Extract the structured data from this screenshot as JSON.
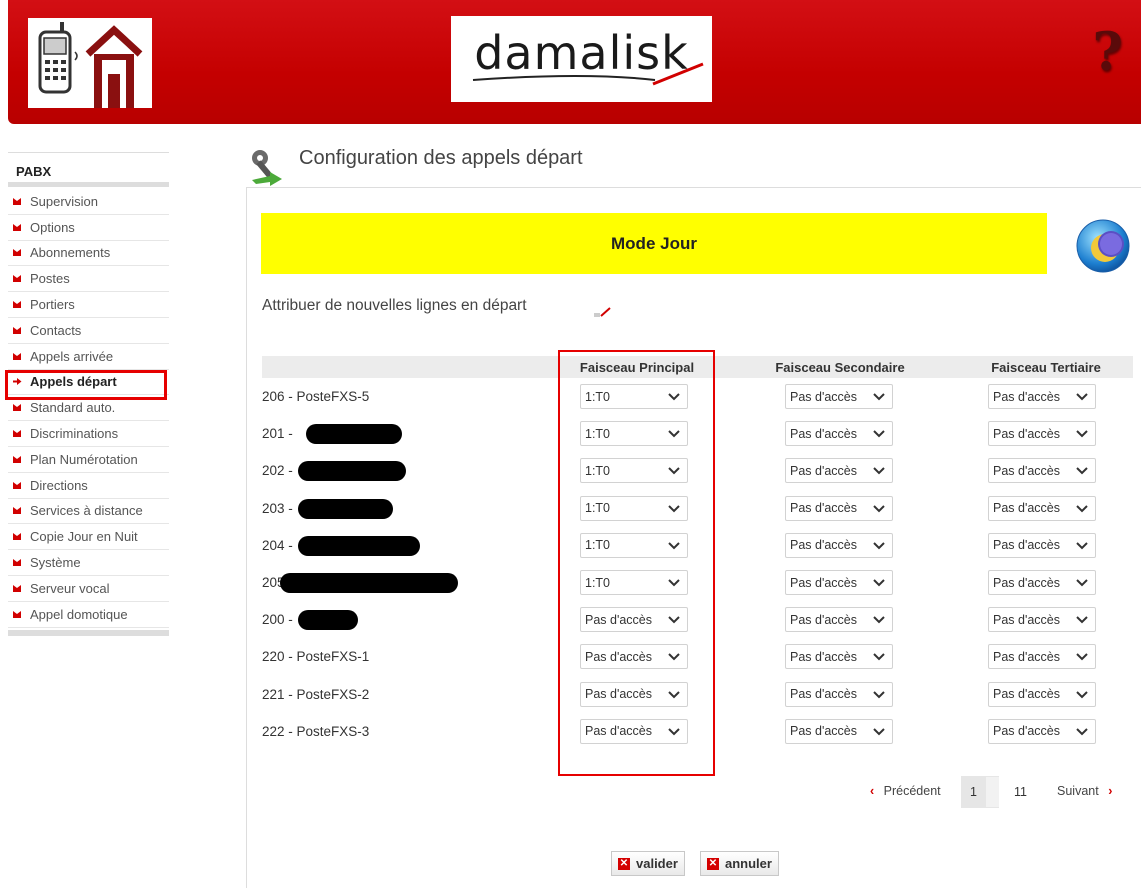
{
  "header": {
    "brand": "damalisk",
    "help": "?"
  },
  "sidebar": {
    "title": "PABX",
    "items": [
      {
        "label": "Supervision"
      },
      {
        "label": "Options"
      },
      {
        "label": "Abonnements"
      },
      {
        "label": "Postes"
      },
      {
        "label": "Portiers"
      },
      {
        "label": "Contacts"
      },
      {
        "label": "Appels arrivée"
      },
      {
        "label": "Appels départ"
      },
      {
        "label": "Standard auto."
      },
      {
        "label": "Discriminations"
      },
      {
        "label": "Plan Numérotation"
      },
      {
        "label": "Directions"
      },
      {
        "label": "Services à distance"
      },
      {
        "label": "Copie Jour en Nuit"
      },
      {
        "label": "Système"
      },
      {
        "label": "Serveur vocal"
      },
      {
        "label": "Appel domotique"
      }
    ],
    "active_index": 7
  },
  "page": {
    "title": "Configuration des appels départ",
    "mode": "Mode Jour",
    "assign_label": "Attribuer de nouvelles lignes en départ"
  },
  "table": {
    "columns": [
      "Faisceau Principal",
      "Faisceau Secondaire",
      "Faisceau Tertiaire"
    ],
    "rows": [
      {
        "label": "206 - PosteFXS-5",
        "principal": "1:T0",
        "secondaire": "Pas d'accès",
        "tertiaire": "Pas d'accès"
      },
      {
        "label": "201 -",
        "principal": "1:T0",
        "secondaire": "Pas d'accès",
        "tertiaire": "Pas d'accès"
      },
      {
        "label": "202 -",
        "principal": "1:T0",
        "secondaire": "Pas d'accès",
        "tertiaire": "Pas d'accès"
      },
      {
        "label": "203 -",
        "principal": "1:T0",
        "secondaire": "Pas d'accès",
        "tertiaire": "Pas d'accès"
      },
      {
        "label": "204 -",
        "principal": "1:T0",
        "secondaire": "Pas d'accès",
        "tertiaire": "Pas d'accès"
      },
      {
        "label": "205",
        "principal": "1:T0",
        "secondaire": "Pas d'accès",
        "tertiaire": "Pas d'accès"
      },
      {
        "label": "200 -",
        "principal": "Pas d'accès",
        "secondaire": "Pas d'accès",
        "tertiaire": "Pas d'accès"
      },
      {
        "label": "220 - PosteFXS-1",
        "principal": "Pas d'accès",
        "secondaire": "Pas d'accès",
        "tertiaire": "Pas d'accès"
      },
      {
        "label": "221 - PosteFXS-2",
        "principal": "Pas d'accès",
        "secondaire": "Pas d'accès",
        "tertiaire": "Pas d'accès"
      },
      {
        "label": "222 - PosteFXS-3",
        "principal": "Pas d'accès",
        "secondaire": "Pas d'accès",
        "tertiaire": "Pas d'accès"
      }
    ]
  },
  "pagination": {
    "previous": "Précédent",
    "current": "1",
    "total": "11",
    "next": "Suivant"
  },
  "actions": {
    "validate": "valider",
    "cancel": "annuler"
  },
  "colors": {
    "header_red": "#c40000",
    "banner_yellow": "#ffff00",
    "highlight_red": "#e60000"
  },
  "icons": {
    "sidebar_bullet": "red-arrow-icon",
    "active_bullet": "red-right-arrow-icon",
    "page": "wrench-gear-icon",
    "mode": "day-night-moon-icon",
    "assign": "edit-pencil-icon",
    "buttons": "red-x-icon"
  }
}
